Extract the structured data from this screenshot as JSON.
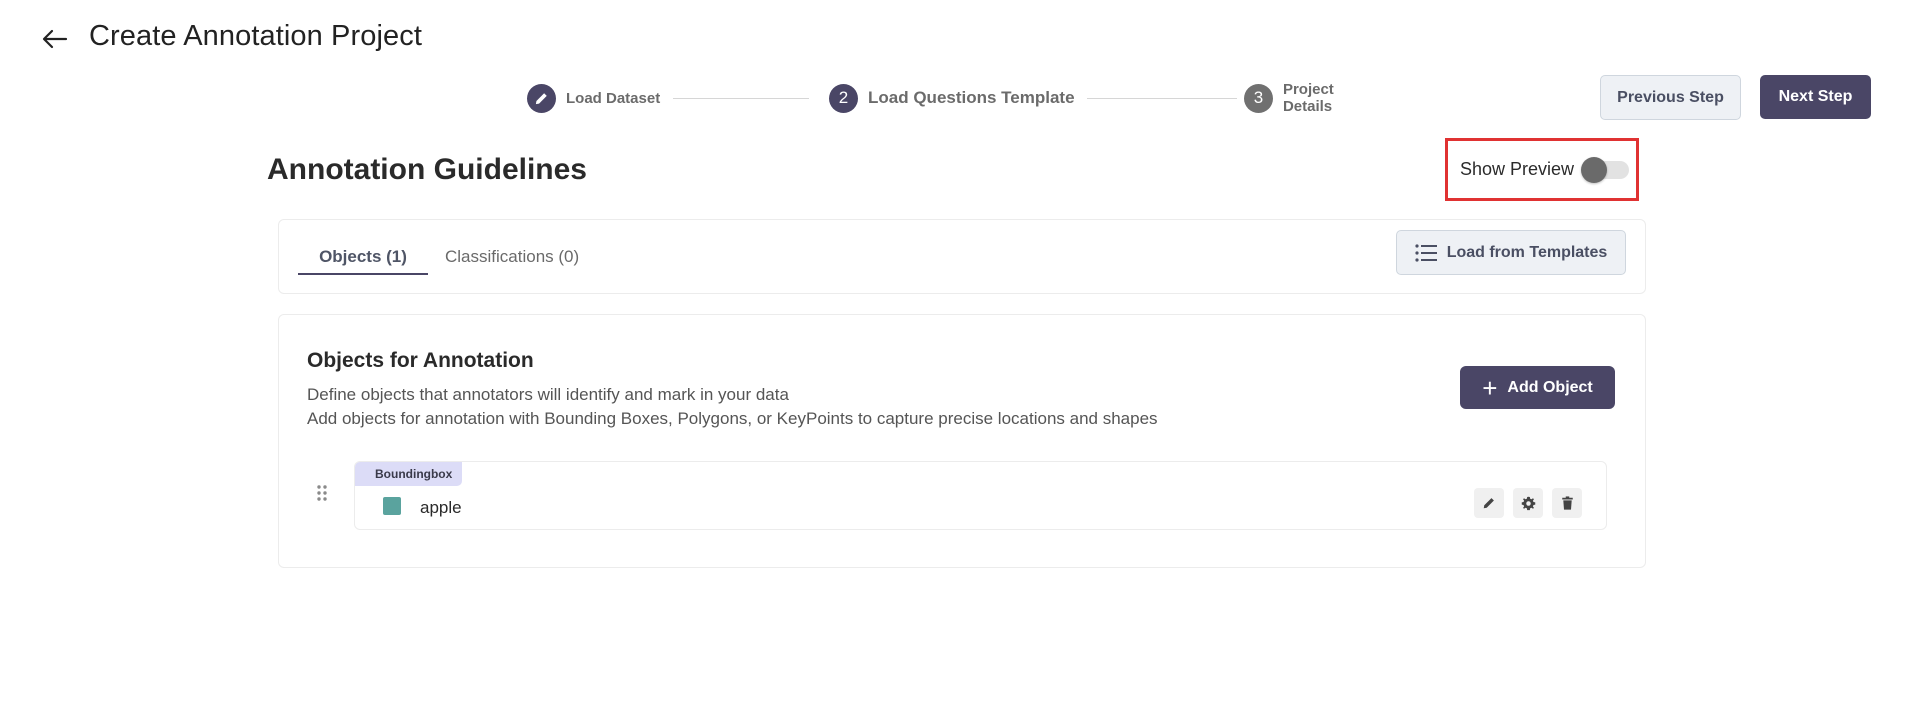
{
  "header": {
    "title": "Create Annotation Project"
  },
  "stepper": {
    "steps": [
      {
        "label": "Load Dataset",
        "number": "",
        "state": "done"
      },
      {
        "label": "Load Questions Template",
        "number": "2",
        "state": "active"
      },
      {
        "label": "Project Details",
        "number": "3",
        "state": "todo"
      }
    ]
  },
  "actions": {
    "previous_label": "Previous Step",
    "next_label": "Next Step"
  },
  "section": {
    "title": "Annotation Guidelines",
    "preview_label": "Show Preview",
    "preview_enabled": false
  },
  "tabs": {
    "items": [
      {
        "label": "Objects (1)",
        "active": true
      },
      {
        "label": "Classifications (0)",
        "active": false
      }
    ],
    "templates_label": "Load from Templates"
  },
  "objects": {
    "title": "Objects for Annotation",
    "desc_line1": "Define objects that annotators will identify and mark in your data",
    "desc_line2": "Add objects for annotation with Bounding Boxes, Polygons, or KeyPoints to capture precise locations and shapes",
    "add_label": "Add Object",
    "items": [
      {
        "type": "Boundingbox",
        "name": "apple",
        "color": "#5aa39e"
      }
    ]
  },
  "colors": {
    "primary": "#4a4666",
    "highlight_border": "#e03232",
    "secondary_bg": "#eef1f5"
  }
}
